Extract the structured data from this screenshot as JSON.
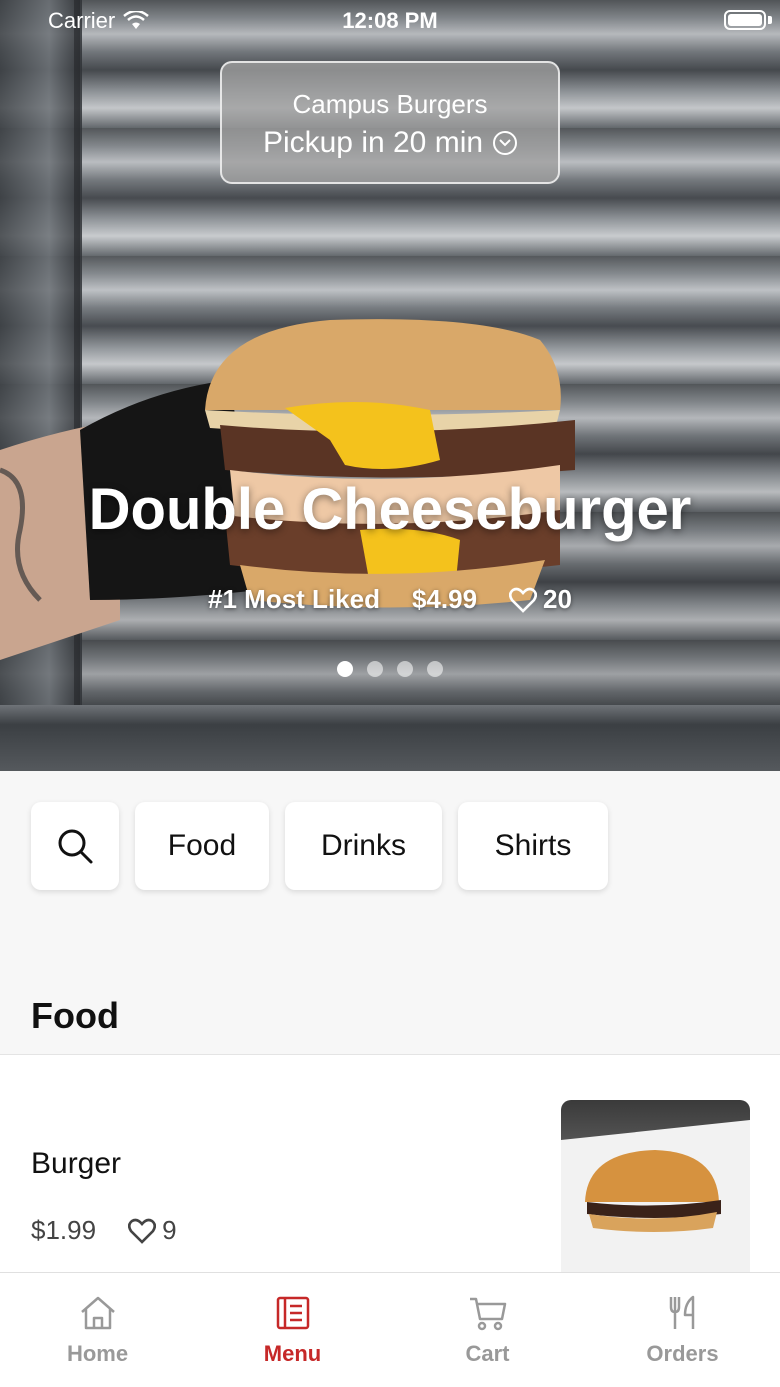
{
  "status_bar": {
    "carrier": "Carrier",
    "time": "12:08 PM"
  },
  "store": {
    "name": "Campus Burgers",
    "pickup": "Pickup in 20 min"
  },
  "featured": {
    "title": "Double Cheeseburger",
    "badge": "#1 Most Liked",
    "price": "$4.99",
    "likes": "20",
    "carousel_active_index": 0,
    "carousel_count": 4
  },
  "categories": {
    "items": [
      "Food",
      "Drinks",
      "Shirts"
    ]
  },
  "section": {
    "title": "Food"
  },
  "menu_item": {
    "name": "Burger",
    "price": "$1.99",
    "likes": "9"
  },
  "tabs": [
    {
      "label": "Home",
      "icon": "home-icon"
    },
    {
      "label": "Menu",
      "icon": "menu-icon"
    },
    {
      "label": "Cart",
      "icon": "cart-icon"
    },
    {
      "label": "Orders",
      "icon": "fork-knife-icon"
    }
  ],
  "active_tab": "Menu",
  "colors": {
    "accent": "#c62828",
    "inactive": "#999999",
    "background": "#f7f7f7"
  }
}
